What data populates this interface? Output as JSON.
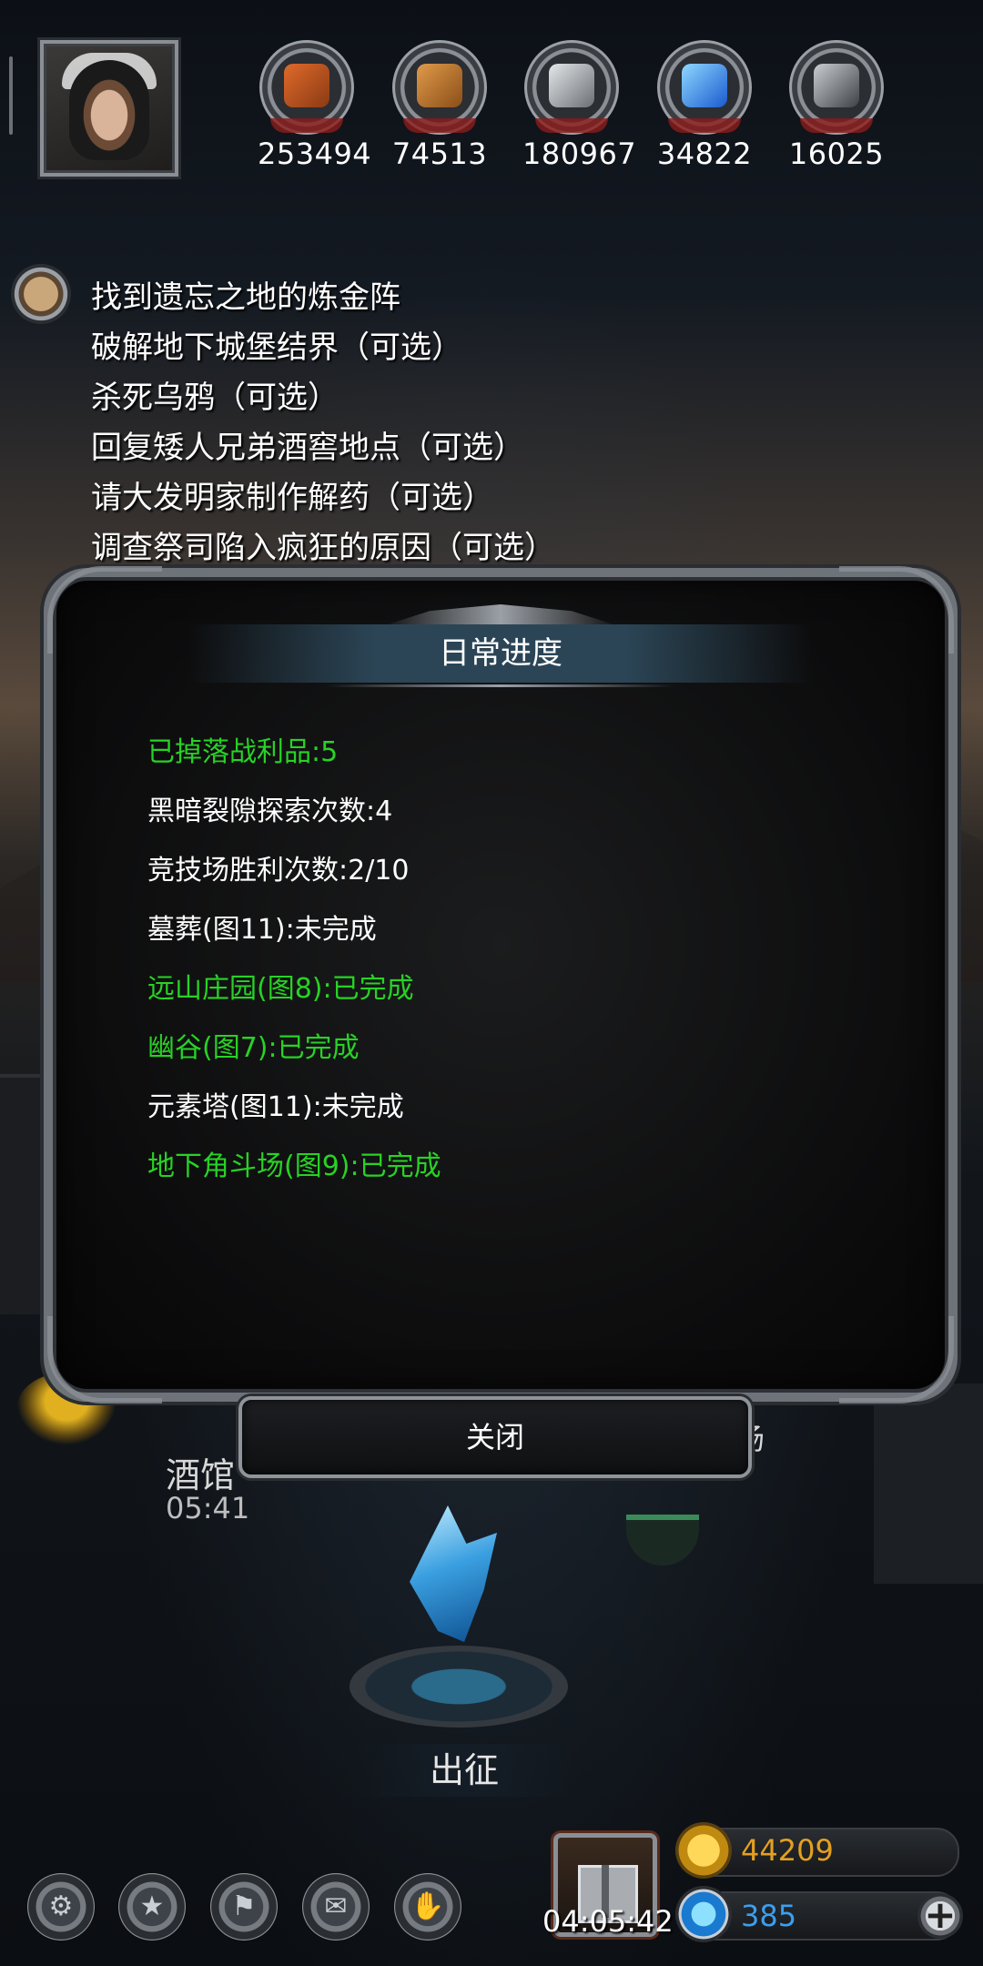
{
  "resources": [
    {
      "icon": "meat-icon",
      "value": "253494",
      "color": "#c8561e"
    },
    {
      "icon": "wood-icon",
      "value": "74513",
      "color": "#c47a2e"
    },
    {
      "icon": "iron-icon",
      "value": "180967",
      "color": "#a9adb2"
    },
    {
      "icon": "crystal-icon",
      "value": "34822",
      "color": "#3a8fe8"
    },
    {
      "icon": "steel-icon",
      "value": "16025",
      "color": "#8a8e93"
    }
  ],
  "quests": [
    "找到遗忘之地的炼金阵",
    "破解地下城堡结界（可选）",
    "杀死乌鸦（可选）",
    "回复矮人兄弟酒窖地点（可选）",
    "请大发明家制作解药（可选）",
    "调查祭司陷入疯狂的原因（可选）"
  ],
  "dialog": {
    "title": "日常进度",
    "items": [
      {
        "text": "已掉落战利品:5",
        "done": true
      },
      {
        "text": "黑暗裂隙探索次数:4",
        "done": false
      },
      {
        "text": "竞技场胜利次数:2/10",
        "done": false
      },
      {
        "text": "墓葬(图11):未完成",
        "done": false
      },
      {
        "text": "远山庄园(图8):已完成",
        "done": true
      },
      {
        "text": "幽谷(图7):已完成",
        "done": true
      },
      {
        "text": "元素塔(图11):未完成",
        "done": false
      },
      {
        "text": "地下角斗场(图9):已完成",
        "done": true
      }
    ],
    "close_label": "关闭"
  },
  "map": {
    "right_chip": "场",
    "right_chip_2": "场",
    "tavern_label": "酒馆",
    "tavern_timer": "05:41",
    "depart_label": "出征"
  },
  "bottom": {
    "buttons": [
      {
        "icon": "gear-icon",
        "glyph": "⚙"
      },
      {
        "icon": "star-icon",
        "glyph": "★"
      },
      {
        "icon": "banner-icon",
        "glyph": "⚑"
      },
      {
        "icon": "mail-icon",
        "glyph": "✉"
      },
      {
        "icon": "handshake-icon",
        "glyph": "✋"
      }
    ],
    "gift_timer": "04:05:42",
    "gold": "44209",
    "gems": "385",
    "plus_glyph": "+"
  },
  "colors": {
    "done": "#28d225",
    "pending": "#ffffff",
    "gold": "#e3a020",
    "gem": "#3a9ff0"
  }
}
